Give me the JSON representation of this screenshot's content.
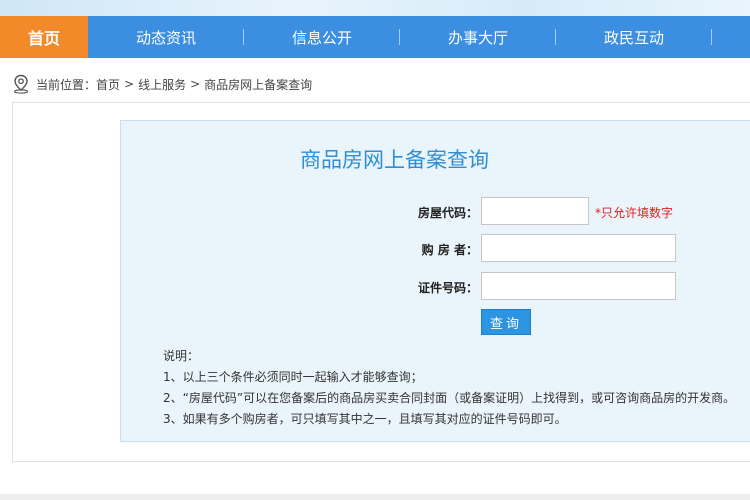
{
  "nav": {
    "items": [
      {
        "label": "首页",
        "active": true
      },
      {
        "label": "动态资讯"
      },
      {
        "label": "信息公开"
      },
      {
        "label": "办事大厅"
      },
      {
        "label": "政民互动"
      }
    ]
  },
  "breadcrumb": {
    "prefix": "当前位置：",
    "items": [
      "首页",
      "线上服务",
      "商品房网上备案查询"
    ],
    "separator": ">"
  },
  "form": {
    "title": "商品房网上备案查询",
    "house_code_label": "房屋代码：",
    "house_code_value": "",
    "house_code_hint": "*只允许填数字",
    "buyer_label": "购 房 者：",
    "buyer_value": "",
    "id_label": "证件号码：",
    "id_value": "",
    "submit_label": "查询"
  },
  "notes": {
    "heading": "说明：",
    "lines": [
      "1、以上三个条件必须同时一起输入才能够查询；",
      "2、“房屋代码”可以在您备案后的商品房买卖合同封面（或备案证明）上找得到，或可咨询商品房的开发商。",
      "3、如果有多个购房者，可只填写其中之一，且填写其对应的证件号码即可。"
    ]
  },
  "colors": {
    "nav_bg": "#3c8fe0",
    "nav_active": "#f28a2a",
    "title": "#2f8fd6",
    "hint": "#e02020",
    "button": "#2d94e2"
  }
}
